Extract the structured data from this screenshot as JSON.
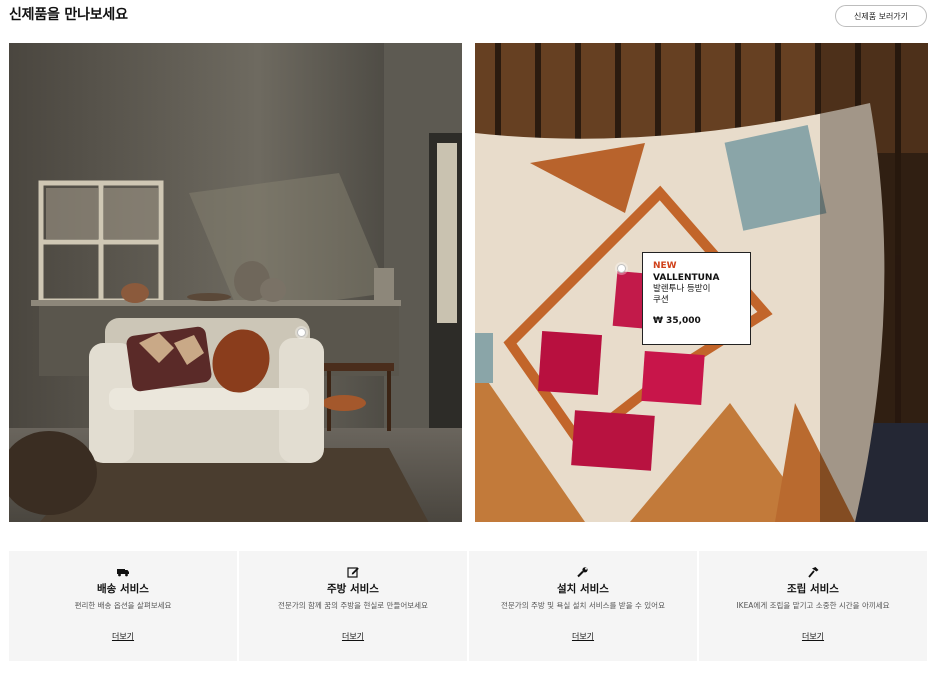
{
  "header": {
    "title": "신제품을 만나보세요",
    "view_new_button": "신제품 보러가기"
  },
  "hero_left": {
    "image": "living-room-armchair-photo"
  },
  "hero_right": {
    "image": "tufted-cushion-photo",
    "product_tag": {
      "badge": "NEW",
      "name": "VALLENTUNA",
      "description": "발렌투나 등받이쿠션",
      "price": "₩ 35,000"
    }
  },
  "colors": {
    "new_badge": "#d0421b",
    "service_bg": "#f5f5f5"
  },
  "services": [
    {
      "icon": "truck-icon",
      "title": "배송 서비스",
      "description": "편리한 배송 옵션을 살펴보세요",
      "link": "더보기"
    },
    {
      "icon": "pencil-icon",
      "title": "주방 서비스",
      "description": "전문가의 함께 꿈의 주방을 현실로 만들어보세요",
      "link": "더보기"
    },
    {
      "icon": "wrench-icon",
      "title": "설치 서비스",
      "description": "전문가의 주방 및 욕실 설치 서비스를 받을 수 있어요",
      "link": "더보기"
    },
    {
      "icon": "hammer-icon",
      "title": "조립 서비스",
      "description": "IKEA에게 조립을 맡기고 소중한 시간을 아끼세요",
      "link": "더보기"
    }
  ]
}
